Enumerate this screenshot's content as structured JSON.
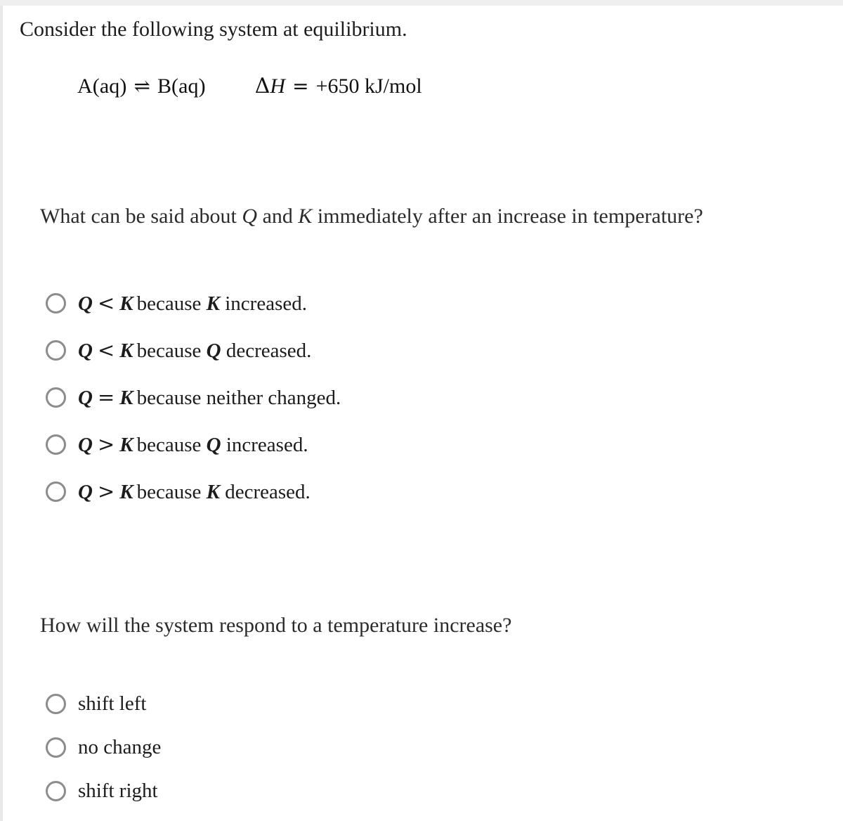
{
  "document": {
    "stem": "Consider the following system at equilibrium.",
    "equation": {
      "left_species": "A(aq)",
      "arrow": "⇌",
      "right_species": "B(aq)",
      "enthalpy_symbol": "Δ",
      "enthalpy_variable": "H",
      "equals": "=",
      "enthalpy_value": "+650 kJ/mol"
    },
    "question_1": {
      "text": "What can be said about Q and K immediately after an increase in temperature?",
      "prefix": "What can be said about ",
      "var_1": "Q",
      "middle": " and ",
      "var_2": "K",
      "suffix": " immediately after an increase in temperature?",
      "options": [
        {
          "left": "Q",
          "relation": "<",
          "right": "K",
          "reason": "because K increased.",
          "reason_prefix": "because ",
          "reason_var": "K",
          "reason_suffix": " increased.",
          "selected": false
        },
        {
          "left": "Q",
          "relation": "<",
          "right": "K",
          "reason": "because Q decreased.",
          "reason_prefix": "because ",
          "reason_var": "Q",
          "reason_suffix": " decreased.",
          "selected": false
        },
        {
          "left": "Q",
          "relation": "=",
          "right": "K",
          "reason": "because neither changed.",
          "reason_prefix": "because neither changed.",
          "reason_var": "",
          "reason_suffix": "",
          "selected": false
        },
        {
          "left": "Q",
          "relation": ">",
          "right": "K",
          "reason": "because Q increased.",
          "reason_prefix": "because ",
          "reason_var": "Q",
          "reason_suffix": " increased.",
          "selected": false
        },
        {
          "left": "Q",
          "relation": ">",
          "right": "K",
          "reason": "because K decreased.",
          "reason_prefix": "because ",
          "reason_var": "K",
          "reason_suffix": " decreased.",
          "selected": false
        }
      ]
    },
    "question_2": {
      "text": "How will the system respond to a temperature increase?",
      "options": [
        {
          "label": "shift left",
          "selected": false
        },
        {
          "label": "no change",
          "selected": false
        },
        {
          "label": "shift right",
          "selected": false
        }
      ]
    }
  },
  "colors": {
    "page_background": "#ffffff",
    "body_text": "#1c1c1c",
    "question_text": "#2b2b2b",
    "radio_border": "#8c8c8c",
    "top_strip": "#efeff0",
    "left_rule": "#e9e9ea"
  }
}
